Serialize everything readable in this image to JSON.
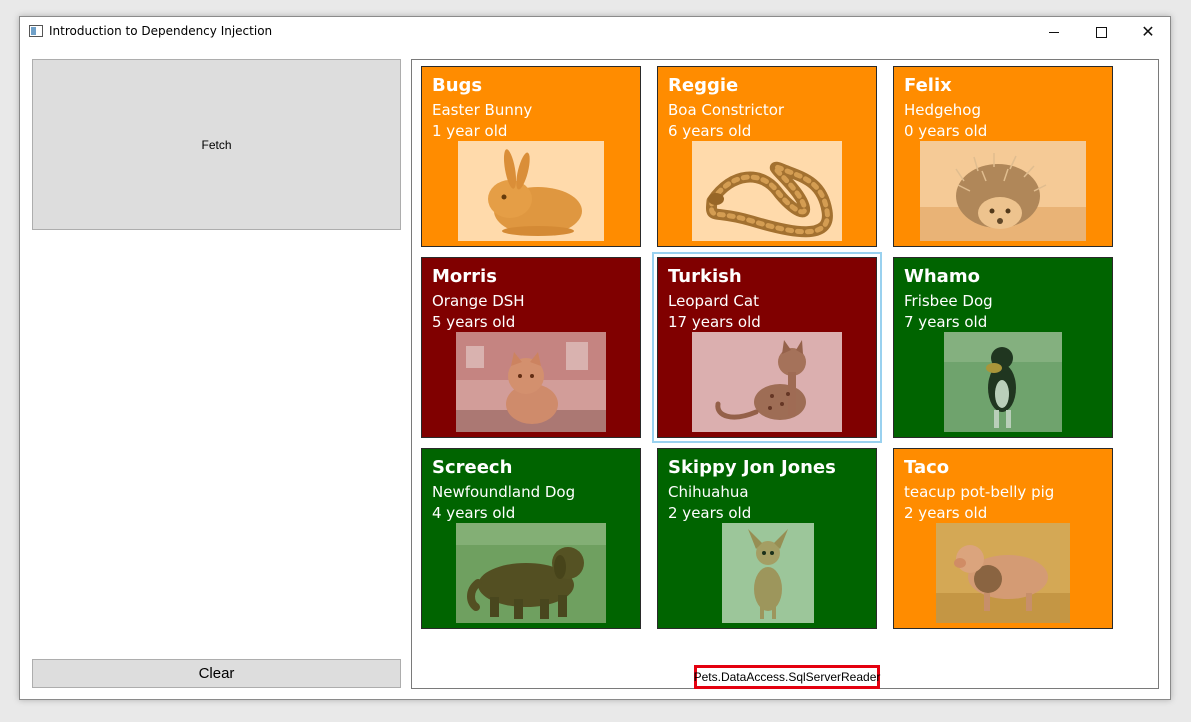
{
  "window": {
    "title": "Introduction to Dependency Injection"
  },
  "buttons": {
    "fetch_label": "Fetch",
    "clear_label": "Clear"
  },
  "reader_label": "Pets.DataAccess.SqlServerReader",
  "colors": {
    "orange": "#ff8c00",
    "maroon": "#800000",
    "green": "#006400",
    "selection": "#99d1ef",
    "reader_border": "#e4000f"
  },
  "pets": [
    {
      "name": "Bugs",
      "breed": "Easter Bunny",
      "age": "1 year old",
      "color": "orange",
      "photo": "rabbit"
    },
    {
      "name": "Reggie",
      "breed": "Boa Constrictor",
      "age": "6 years old",
      "color": "orange",
      "photo": "snake"
    },
    {
      "name": "Felix",
      "breed": "Hedgehog",
      "age": "0 years old",
      "color": "orange",
      "photo": "hedgehog"
    },
    {
      "name": "Morris",
      "breed": "Orange DSH",
      "age": "5 years old",
      "color": "maroon",
      "photo": "orange-cat"
    },
    {
      "name": "Turkish",
      "breed": "Leopard Cat",
      "age": "17 years old",
      "color": "maroon",
      "photo": "leopard-cat",
      "selected": true
    },
    {
      "name": "Whamo",
      "breed": "Frisbee Dog",
      "age": "7 years old",
      "color": "green",
      "photo": "border-collie"
    },
    {
      "name": "Screech",
      "breed": "Newfoundland Dog",
      "age": "4 years old",
      "color": "green",
      "photo": "newfoundland-dog"
    },
    {
      "name": "Skippy Jon Jones",
      "breed": "Chihuahua",
      "age": "2 years old",
      "color": "green",
      "photo": "chihuahua"
    },
    {
      "name": "Taco",
      "breed": "teacup pot-belly pig",
      "age": "2 years old",
      "color": "orange",
      "photo": "pig"
    }
  ]
}
